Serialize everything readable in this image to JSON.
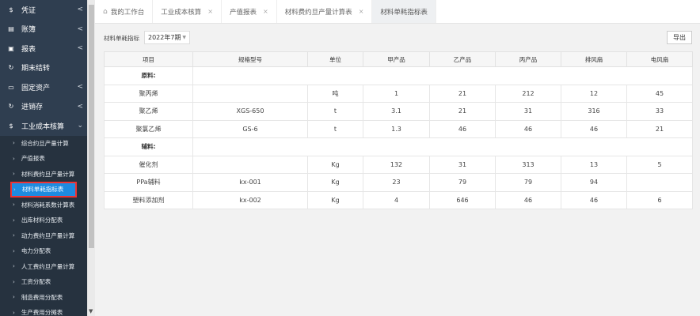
{
  "sidebar": {
    "top_items": [
      {
        "icon": "dollar-icon",
        "glyph": "$",
        "label": "凭证",
        "chevron": "<"
      },
      {
        "icon": "book-icon",
        "glyph": "▤",
        "label": "账簿",
        "chevron": "<"
      },
      {
        "icon": "report-icon",
        "glyph": "▣",
        "label": "报表",
        "chevron": "<"
      },
      {
        "icon": "refresh-icon",
        "glyph": "↻",
        "label": "期末结转",
        "chevron": ""
      },
      {
        "icon": "monitor-icon",
        "glyph": "▭",
        "label": "固定资产",
        "chevron": "<"
      },
      {
        "icon": "cycle-icon",
        "glyph": "↻",
        "label": "进销存",
        "chevron": "<"
      },
      {
        "icon": "dollar-icon",
        "glyph": "$",
        "label": "工业成本核算",
        "chevron": "⌄"
      }
    ],
    "sub_items": [
      {
        "label": "综合约旦产量计算"
      },
      {
        "label": "产值报表"
      },
      {
        "label": "材料费约旦产量计算"
      },
      {
        "label": "材料单耗指标表"
      },
      {
        "label": "材料消耗系数计算表"
      },
      {
        "label": "出库材料分配表"
      },
      {
        "label": "动力费约旦产量计算"
      },
      {
        "label": "电力分配表"
      },
      {
        "label": "人工费约旦产量计算"
      },
      {
        "label": "工资分配表"
      },
      {
        "label": "制造费用分配表"
      },
      {
        "label": "生产费用分摊表"
      }
    ],
    "active_sub_index": 3
  },
  "tabs": [
    {
      "label": "我的工作台",
      "home": true,
      "closable": false
    },
    {
      "label": "工业成本核算",
      "home": false,
      "closable": true
    },
    {
      "label": "产值报表",
      "home": false,
      "closable": true
    },
    {
      "label": "材料费约旦产量计算表",
      "home": false,
      "closable": true
    },
    {
      "label": "材料单耗指标表",
      "home": false,
      "closable": false,
      "active": true
    }
  ],
  "toolbar": {
    "filter_label": "材料单耗指标",
    "period_value": "2022年7期",
    "export_label": "导出"
  },
  "table": {
    "headers": [
      "项目",
      "规格型号",
      "单位",
      "甲产品",
      "乙产品",
      "丙产品",
      "排风扇",
      "电风扇"
    ],
    "rows": [
      {
        "section": true,
        "cells": [
          "原料:",
          "",
          "",
          "",
          "",
          "",
          "",
          ""
        ]
      },
      {
        "section": false,
        "cells": [
          "聚丙烯",
          "",
          "吨",
          "1",
          "21",
          "212",
          "12",
          "45"
        ]
      },
      {
        "section": false,
        "cells": [
          "聚乙烯",
          "XGS-650",
          "t",
          "3.1",
          "21",
          "31",
          "316",
          "33"
        ]
      },
      {
        "section": false,
        "cells": [
          "聚氯乙烯",
          "GS-6",
          "t",
          "1.3",
          "46",
          "46",
          "46",
          "21"
        ]
      },
      {
        "section": true,
        "cells": [
          "辅料:",
          "",
          "",
          "",
          "",
          "",
          "",
          ""
        ]
      },
      {
        "section": false,
        "cells": [
          "催化剂",
          "",
          "Kg",
          "132",
          "31",
          "313",
          "13",
          "5"
        ]
      },
      {
        "section": false,
        "cells": [
          "PPa辅料",
          "kx-001",
          "Kg",
          "23",
          "79",
          "79",
          "94",
          ""
        ]
      },
      {
        "section": false,
        "cells": [
          "塑料添加剂",
          "kx-002",
          "Kg",
          "4",
          "646",
          "46",
          "46",
          "6"
        ]
      }
    ]
  },
  "colors": {
    "sidebar_bg": "#2f3e50",
    "active_item": "#1e8be0",
    "active_outline": "#e33333"
  }
}
